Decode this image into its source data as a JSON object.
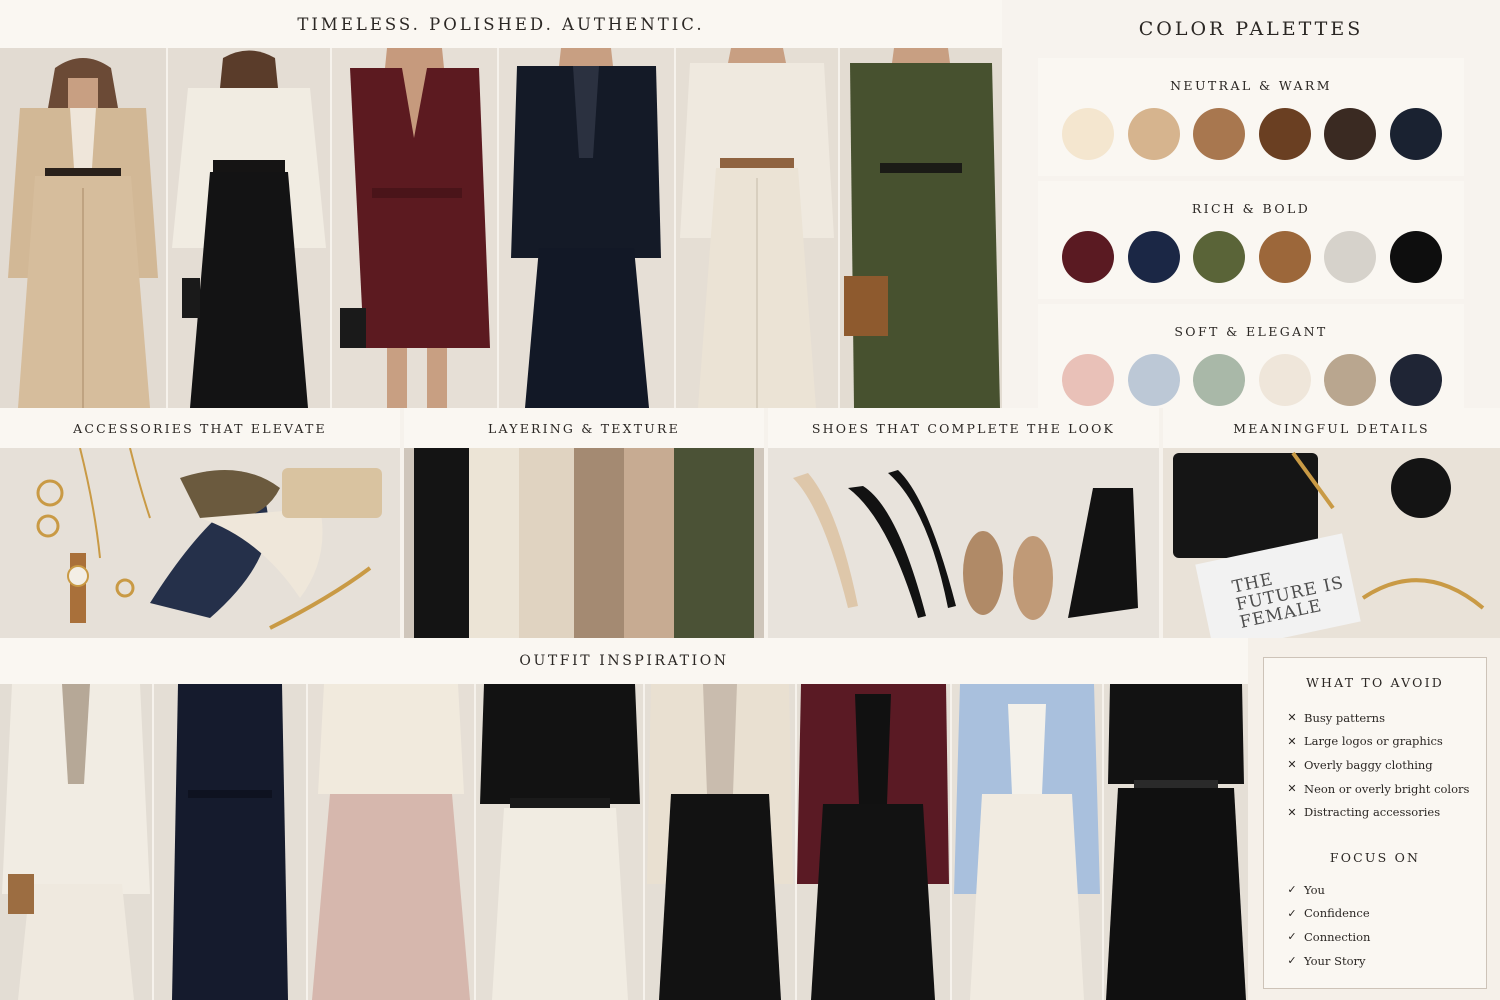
{
  "header": {
    "title": "TIMELESS. POLISHED. AUTHENTIC."
  },
  "palettes": {
    "title": "COLOR PALETTES",
    "groups": [
      {
        "name": "NEUTRAL & WARM",
        "colors": [
          "#f4e6cf",
          "#d6b48e",
          "#a8774f",
          "#6a3f22",
          "#3a2a22",
          "#1a2231"
        ]
      },
      {
        "name": "RICH & BOLD",
        "colors": [
          "#5a1a22",
          "#1b2745",
          "#5a6438",
          "#9c673a",
          "#d6d2cb",
          "#0e0e0e"
        ]
      },
      {
        "name": "SOFT & ELEGANT",
        "colors": [
          "#e9c1b8",
          "#bcc8d6",
          "#a9b8a8",
          "#efe6da",
          "#b9a68f",
          "#1f2535"
        ]
      }
    ]
  },
  "sections": {
    "accessories": "ACCESSORIES THAT ELEVATE",
    "layering": "LAYERING & TEXTURE",
    "shoes": "SHOES THAT COMPLETE THE LOOK",
    "details": "MEANINGFUL DETAILS",
    "outfits": "OUTFIT INSPIRATION"
  },
  "book_cover": {
    "title": "THE FUTURE IS FEMALE"
  },
  "avoid": {
    "title": "WHAT TO AVOID",
    "icon": "x-mark-icon",
    "items": [
      "Busy patterns",
      "Large logos or graphics",
      "Overly baggy clothing",
      "Neon or overly bright colors",
      "Distracting accessories"
    ]
  },
  "focus": {
    "title": "FOCUS ON",
    "icon": "check-mark-icon",
    "items": [
      "You",
      "Confidence",
      "Connection",
      "Your Story"
    ]
  }
}
